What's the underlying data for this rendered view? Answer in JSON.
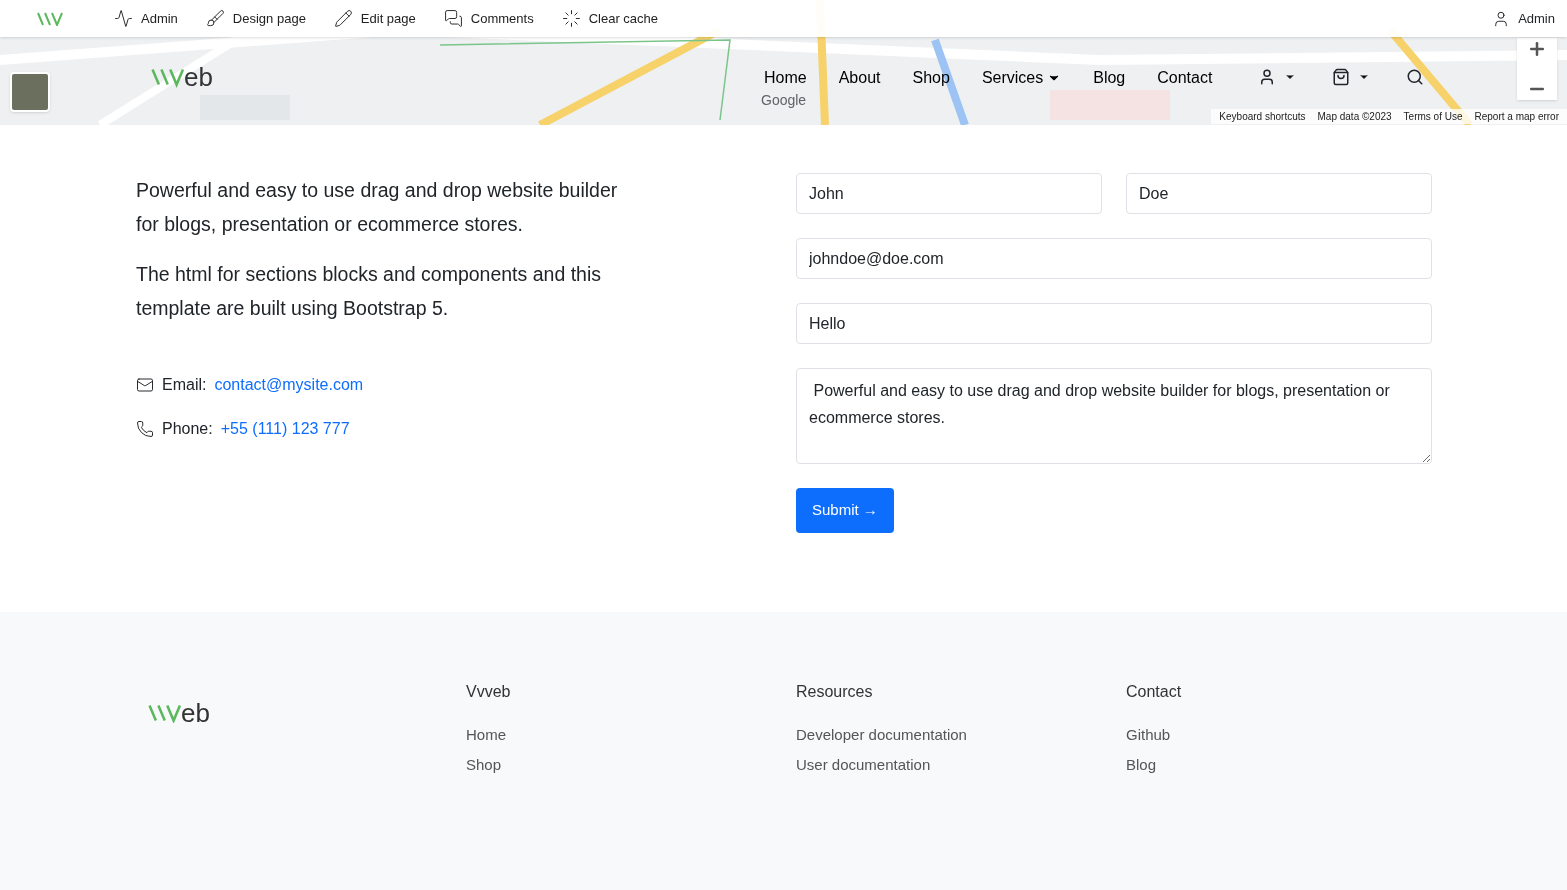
{
  "admin_bar": {
    "items": [
      {
        "kind": "pulse",
        "label": "Admin"
      },
      {
        "kind": "brush",
        "label": "Design page"
      },
      {
        "kind": "pencil",
        "label": "Edit page"
      },
      {
        "kind": "comments",
        "label": "Comments"
      },
      {
        "kind": "reload",
        "label": "Clear cache"
      }
    ],
    "user": "Admin"
  },
  "header": {
    "logo_text": "eb",
    "nav": [
      {
        "label": "Home",
        "dropdown": false
      },
      {
        "label": "About",
        "dropdown": false
      },
      {
        "label": "Shop",
        "dropdown": false
      },
      {
        "label": "Services",
        "dropdown": true
      },
      {
        "label": "Blog",
        "dropdown": false
      },
      {
        "label": "Contact",
        "dropdown": false
      }
    ]
  },
  "map": {
    "provider": "Google",
    "footer_links": [
      "Keyboard shortcuts",
      "Map data ©2023",
      "Terms of Use",
      "Report a map error"
    ]
  },
  "intro": [
    "Powerful and easy to use drag and drop website builder for blogs, presentation or ecommerce stores.",
    "The html for sections blocks and components and this template are built using Bootstrap 5."
  ],
  "contacts": [
    {
      "kind": "email",
      "label": "Email:",
      "value": "contact@mysite.com"
    },
    {
      "kind": "phone",
      "label": "Phone:",
      "value": "+55 (111) 123 777"
    }
  ],
  "form": {
    "first_name": "John",
    "last_name": "Doe",
    "email": "johndoe@doe.com",
    "subject": "Hello",
    "message": " Powerful and easy to use drag and drop website builder for blogs, presentation or ecommerce stores.",
    "submit": "Submit →"
  },
  "footer": {
    "logo_text": "eb",
    "columns": [
      {
        "title": "Vvveb",
        "links": [
          "Home",
          "Shop"
        ]
      },
      {
        "title": "Resources",
        "links": [
          "Developer documentation",
          "User documentation"
        ]
      },
      {
        "title": "Contact",
        "links": [
          "Github",
          "Blog"
        ]
      }
    ]
  }
}
